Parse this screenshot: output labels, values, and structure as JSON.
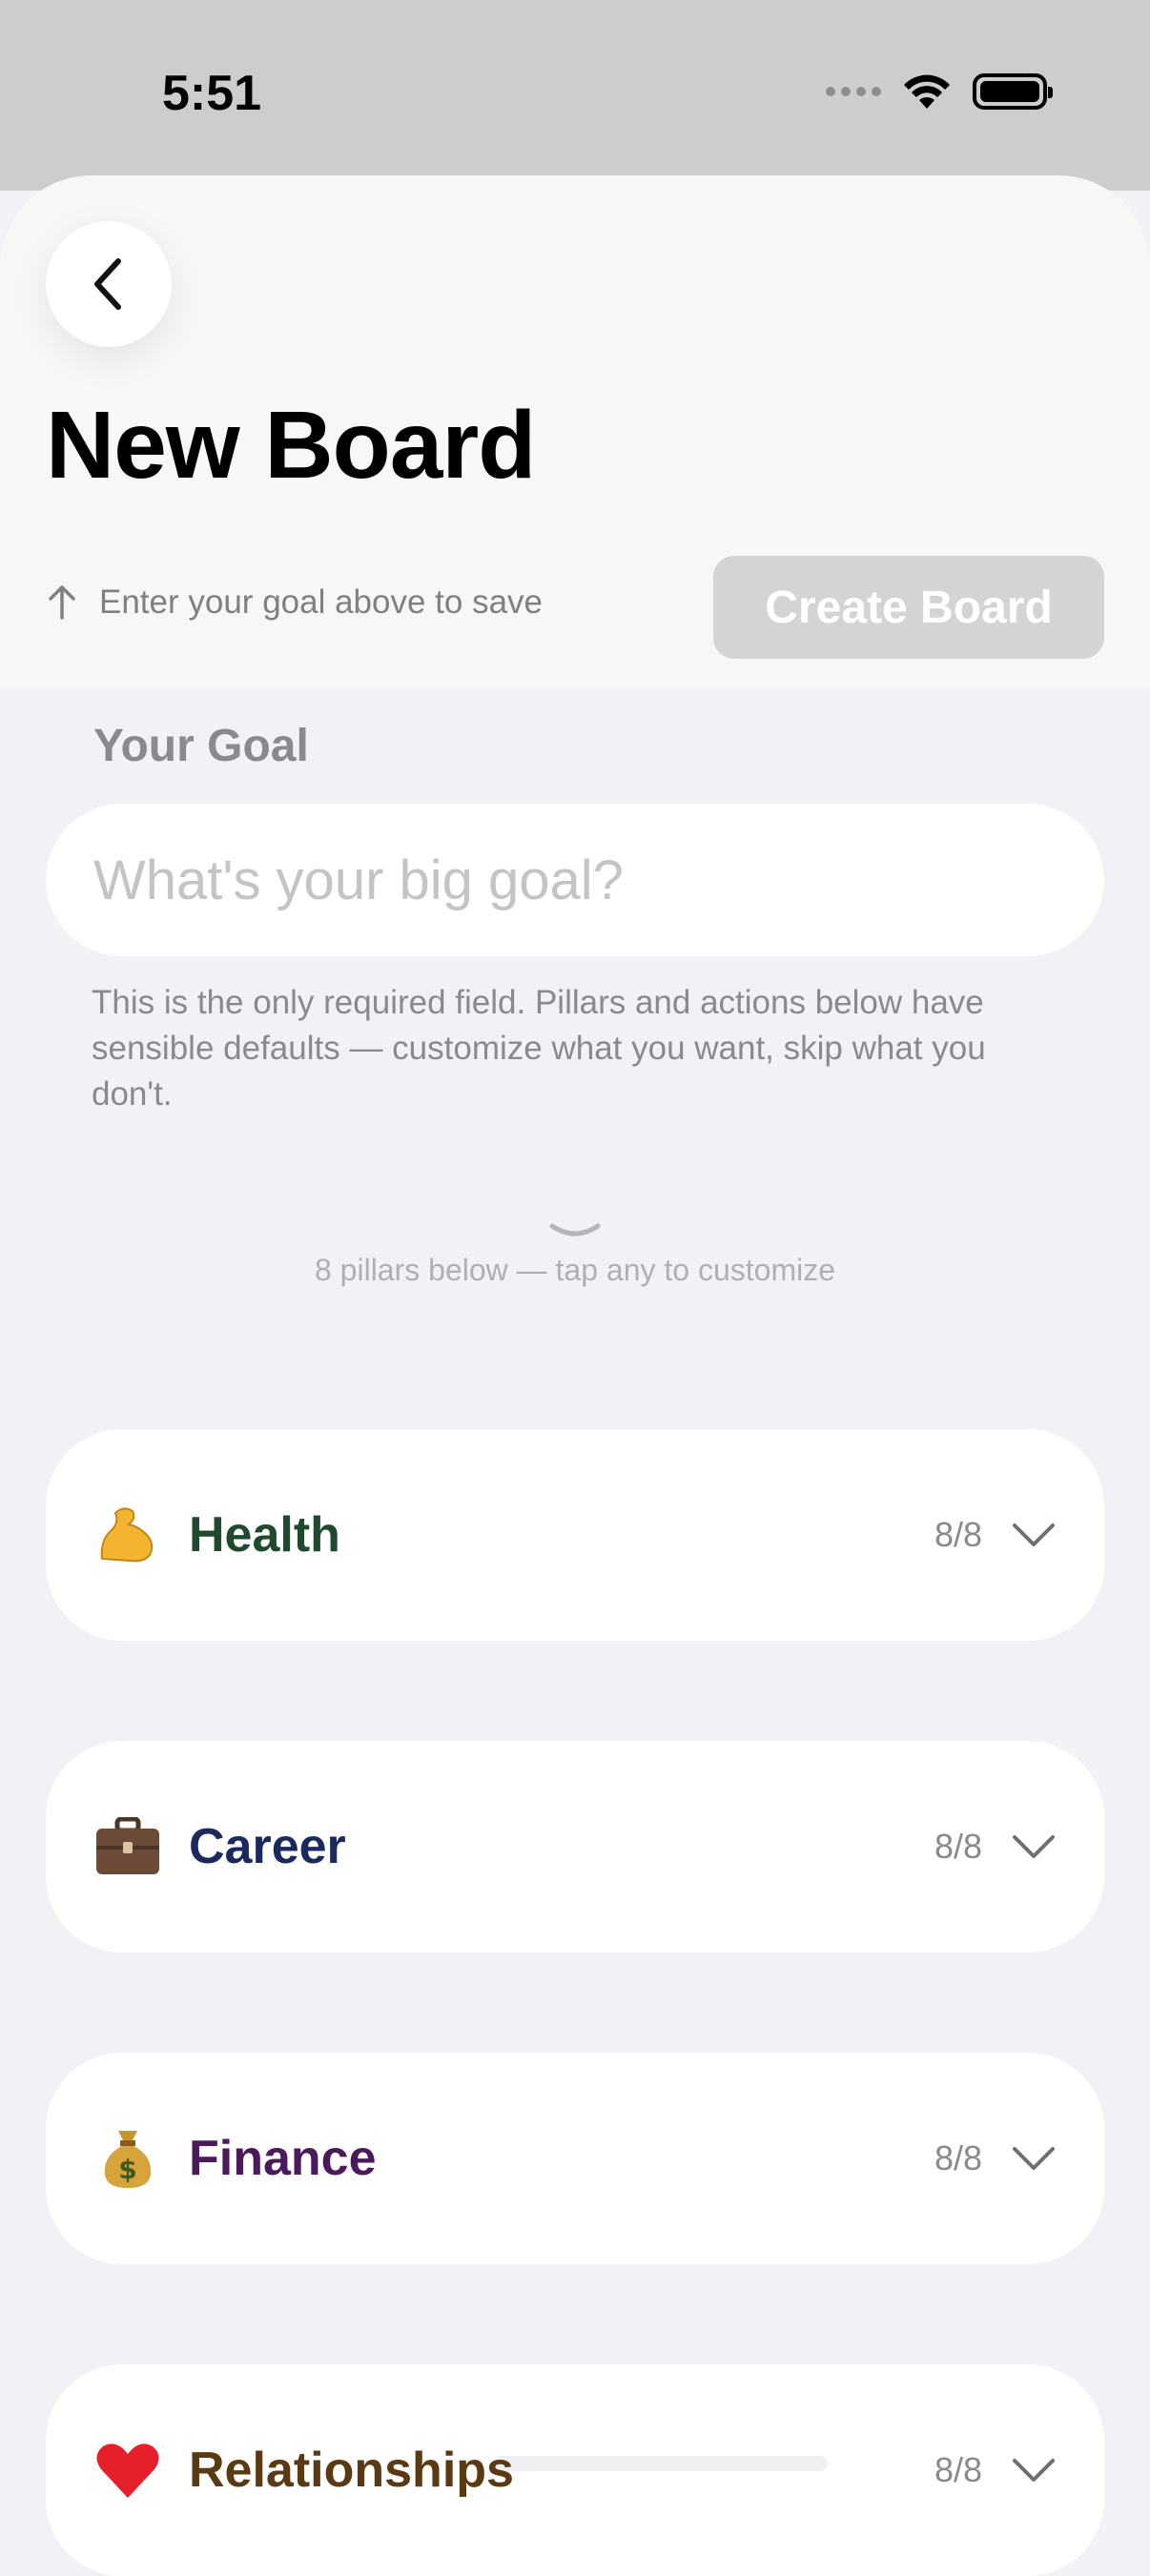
{
  "status_bar": {
    "time": "5:51"
  },
  "header": {
    "title": "New Board",
    "hint": "Enter your goal above to save",
    "create_label": "Create Board"
  },
  "goal": {
    "section_label": "Your Goal",
    "placeholder": "What's your big goal?",
    "value": "",
    "helper": "This is the only required field. Pillars and actions below have sensible defaults — customize what you want, skip what you don't."
  },
  "pillars_hint": "8 pillars below — tap any to customize",
  "pillars": [
    {
      "name": "Health",
      "count": "8/8",
      "icon": "flexed-biceps-icon",
      "color": "#1f4a2e"
    },
    {
      "name": "Career",
      "count": "8/8",
      "icon": "briefcase-icon",
      "color": "#1b2a5e"
    },
    {
      "name": "Finance",
      "count": "8/8",
      "icon": "money-bag-icon",
      "color": "#4a1a5a"
    },
    {
      "name": "Relationships",
      "count": "8/8",
      "icon": "red-heart-icon",
      "color": "#5a3a12"
    }
  ]
}
